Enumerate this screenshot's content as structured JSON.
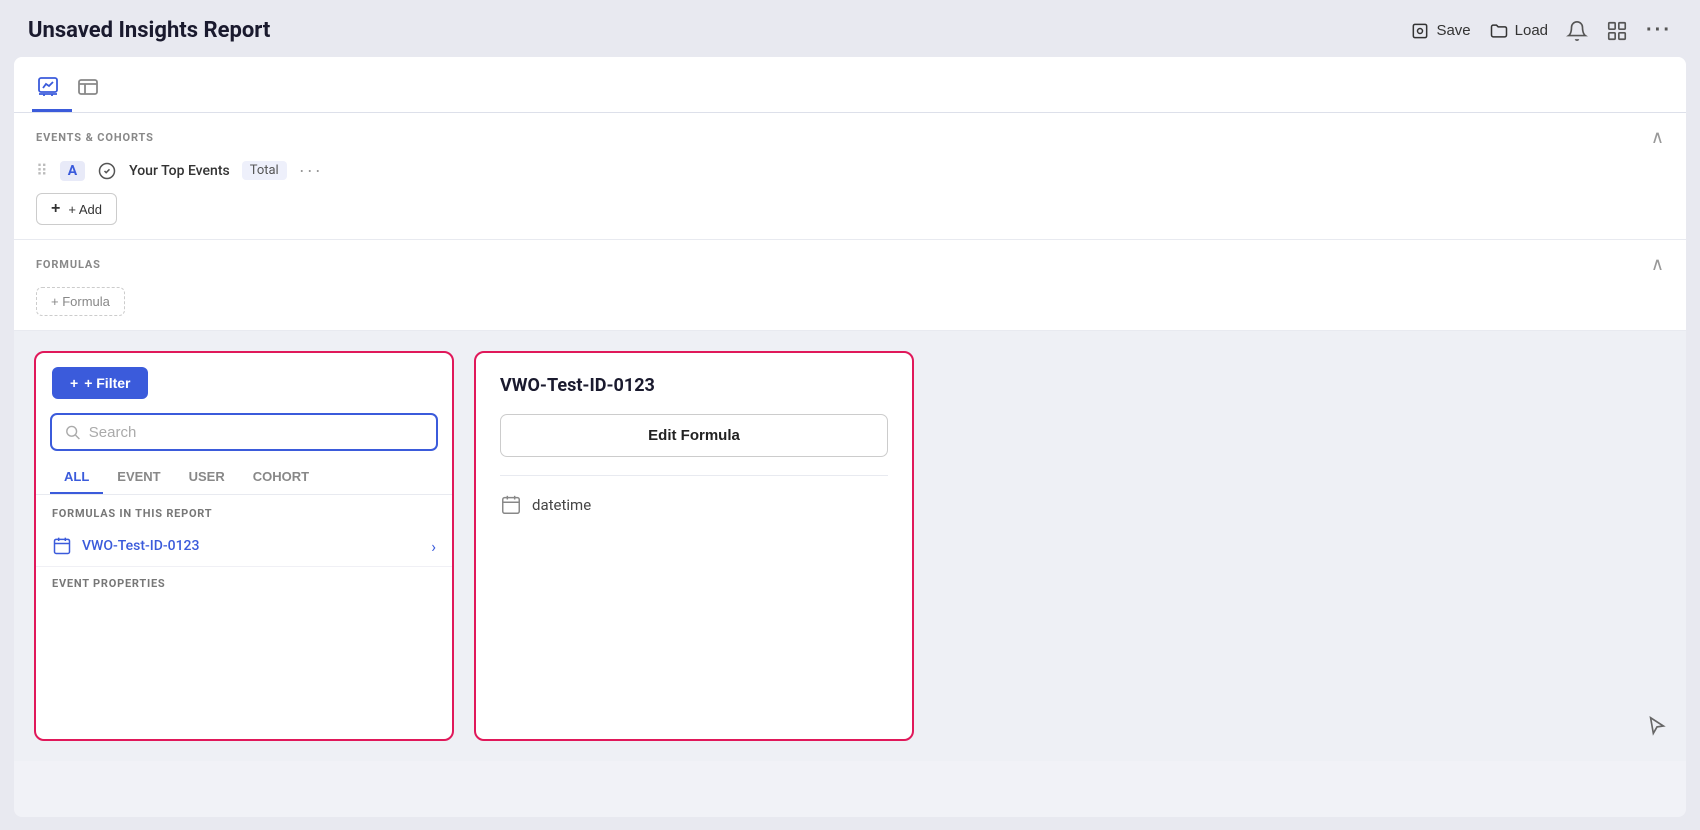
{
  "header": {
    "title": "Unsaved Insights Report",
    "save_label": "Save",
    "load_label": "Load"
  },
  "main": {
    "tabs": [
      {
        "id": "chart",
        "label": "chart-tab",
        "active": true
      },
      {
        "id": "table",
        "label": "table-tab",
        "active": false
      }
    ],
    "events_section": {
      "title": "EVENTS & COHORTS",
      "event": {
        "label": "A",
        "name": "Your Top Events",
        "badge": "Total"
      },
      "add_button": "+ Add"
    },
    "formulas_section": {
      "title": "FORMULAS",
      "formula_button": "+ Formula"
    }
  },
  "filter_panel": {
    "filter_button": "+ Filter",
    "search_placeholder": "Search",
    "tabs": [
      {
        "label": "ALL",
        "active": true
      },
      {
        "label": "EVENT",
        "active": false
      },
      {
        "label": "USER",
        "active": false
      },
      {
        "label": "COHORT",
        "active": false
      }
    ],
    "formulas_section_title": "FORMULAS IN THIS REPORT",
    "formula_item": {
      "name": "VWO-Test-ID-0123",
      "icon": "calendar-icon"
    },
    "event_properties_title": "EVENT PROPERTIES"
  },
  "detail_panel": {
    "title": "VWO-Test-ID-0123",
    "edit_formula_label": "Edit Formula",
    "property": {
      "icon": "calendar-icon",
      "name": "datetime"
    }
  },
  "colors": {
    "accent": "#3b5bdb",
    "border_highlight": "#e0185a",
    "bg": "#e8e9f0"
  }
}
